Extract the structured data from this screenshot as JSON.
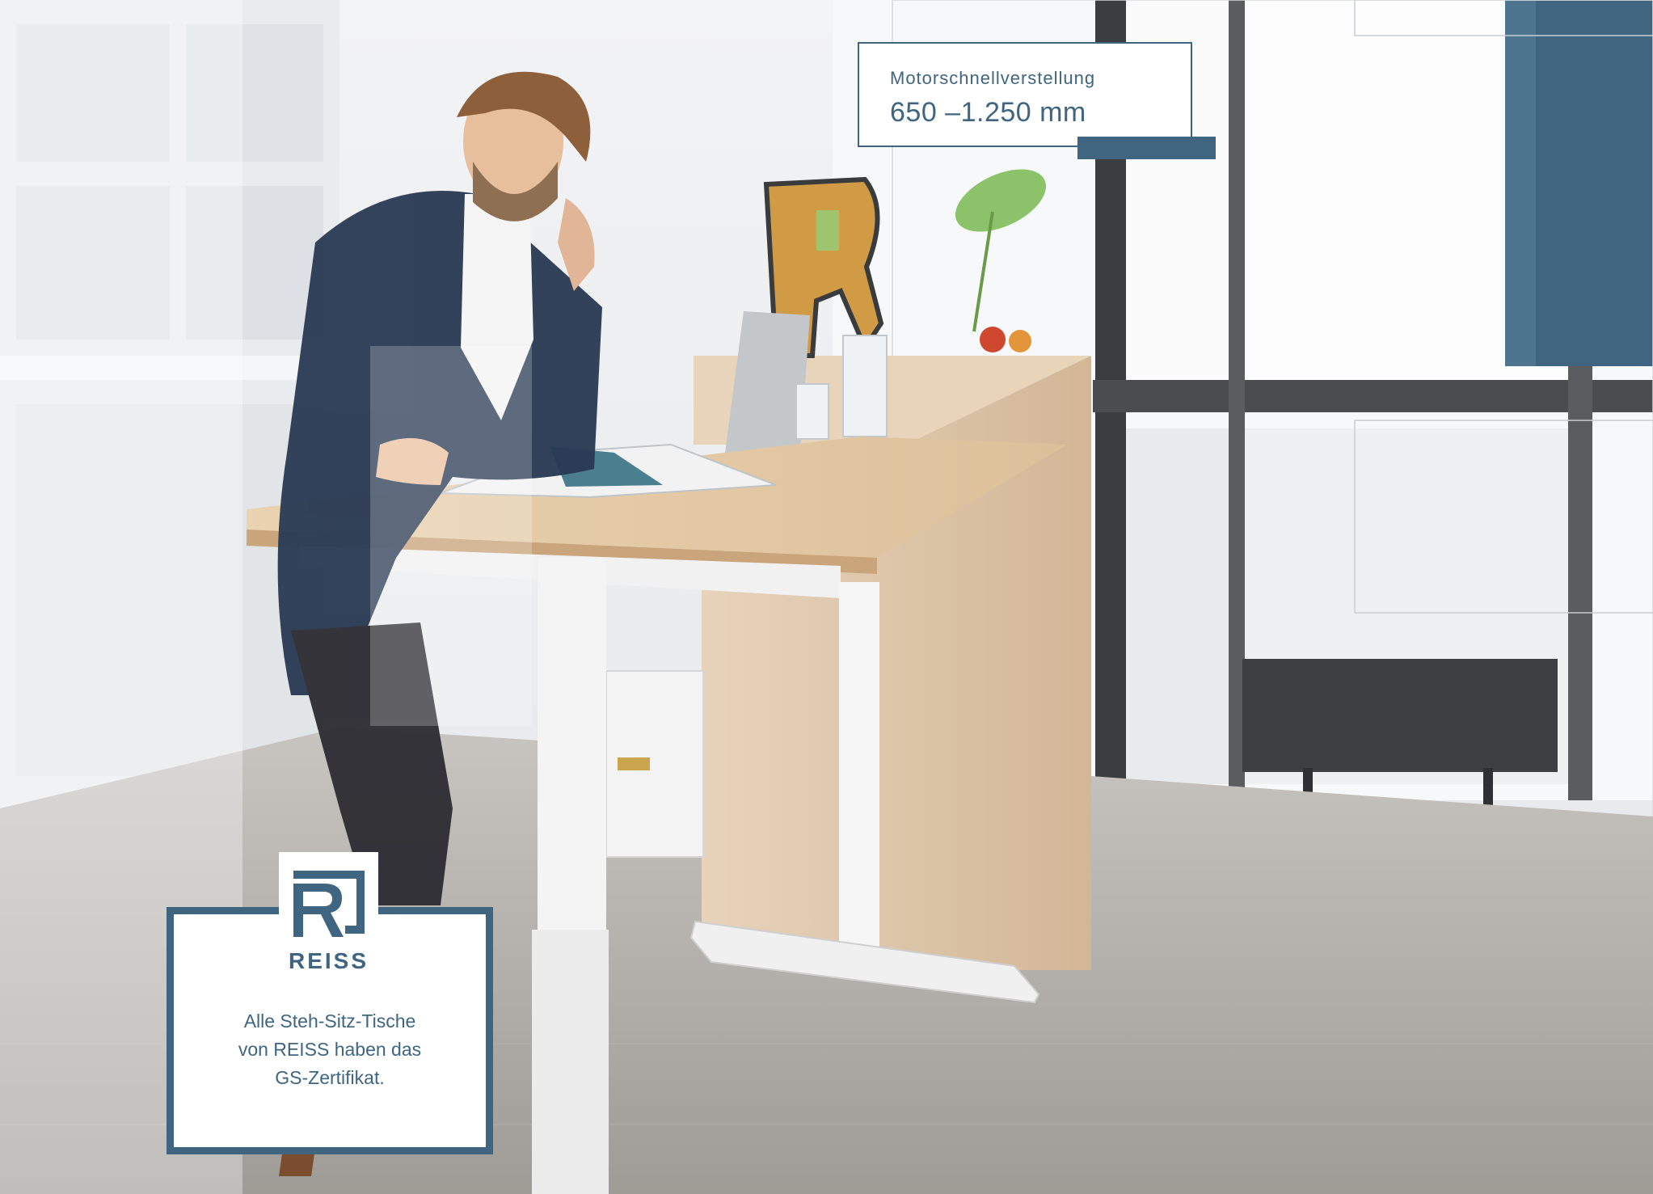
{
  "spec": {
    "label": "Motorschnellverstellung",
    "value": "650 –1.250 mm"
  },
  "brand": {
    "logo_text": "REISS",
    "cert_lines": [
      "Alle Steh-Sitz-Tische",
      "von REISS haben das",
      "GS-Zertifikat."
    ]
  },
  "colors": {
    "accent": "#3f6580",
    "desk_top": "#e6c9a0",
    "floor": "#a9a6a1",
    "wall": "#f3f4f5"
  }
}
